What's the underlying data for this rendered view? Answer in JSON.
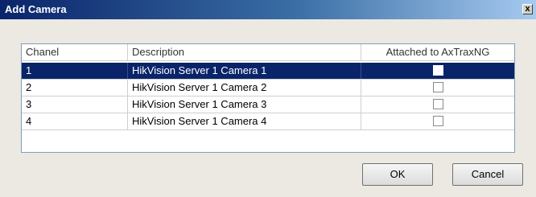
{
  "window": {
    "title": "Add Camera",
    "close_glyph": "x"
  },
  "table": {
    "columns": [
      "Chanel",
      "Description",
      "Attached to AxTraxNG"
    ],
    "rows": [
      {
        "channel": "1",
        "description": "HikVision Server 1 Camera 1",
        "attached": false,
        "selected": true
      },
      {
        "channel": "2",
        "description": "HikVision Server 1 Camera 2",
        "attached": false,
        "selected": false
      },
      {
        "channel": "3",
        "description": "HikVision Server 1 Camera 3",
        "attached": false,
        "selected": false
      },
      {
        "channel": "4",
        "description": "HikVision Server 1 Camera 4",
        "attached": false,
        "selected": false
      }
    ]
  },
  "buttons": {
    "ok": "OK",
    "cancel": "Cancel"
  }
}
